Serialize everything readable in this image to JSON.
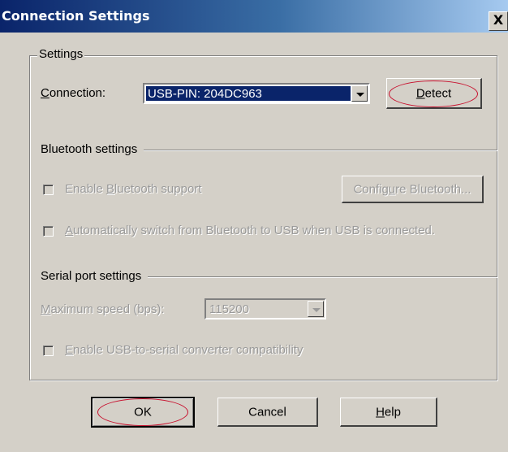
{
  "window": {
    "title": "Connection Settings",
    "close_label": "X"
  },
  "settings": {
    "group_label": "Settings",
    "connection": {
      "label_accel": "C",
      "label_rest": "onnection:",
      "value": "USB-PIN: 204DC963",
      "detect_accel": "D",
      "detect_rest": "etect"
    },
    "bluetooth": {
      "section_label": "Bluetooth settings",
      "enable_pre": "Enable ",
      "enable_accel": "B",
      "enable_rest": "luetooth support",
      "configure_pre": "Config",
      "configure_accel": "u",
      "configure_rest": "re Bluetooth...",
      "auto_accel": "A",
      "auto_rest": "utomatically switch from Bluetooth to USB when USB is connected."
    },
    "serial": {
      "section_label": "Serial port settings",
      "speed_accel": "M",
      "speed_rest": "aximum speed (bps):",
      "speed_value": "115200",
      "converter_accel": "E",
      "converter_rest": "nable USB-to-serial converter compatibility"
    }
  },
  "footer": {
    "ok_label": "OK",
    "cancel_label": "Cancel",
    "help_accel": "H",
    "help_rest": "elp"
  },
  "colors": {
    "title_bar": "#0a246a",
    "selection": "#0a246a",
    "annotation_circle": "#c8102e",
    "dialog_bg": "#d4d0c8"
  }
}
